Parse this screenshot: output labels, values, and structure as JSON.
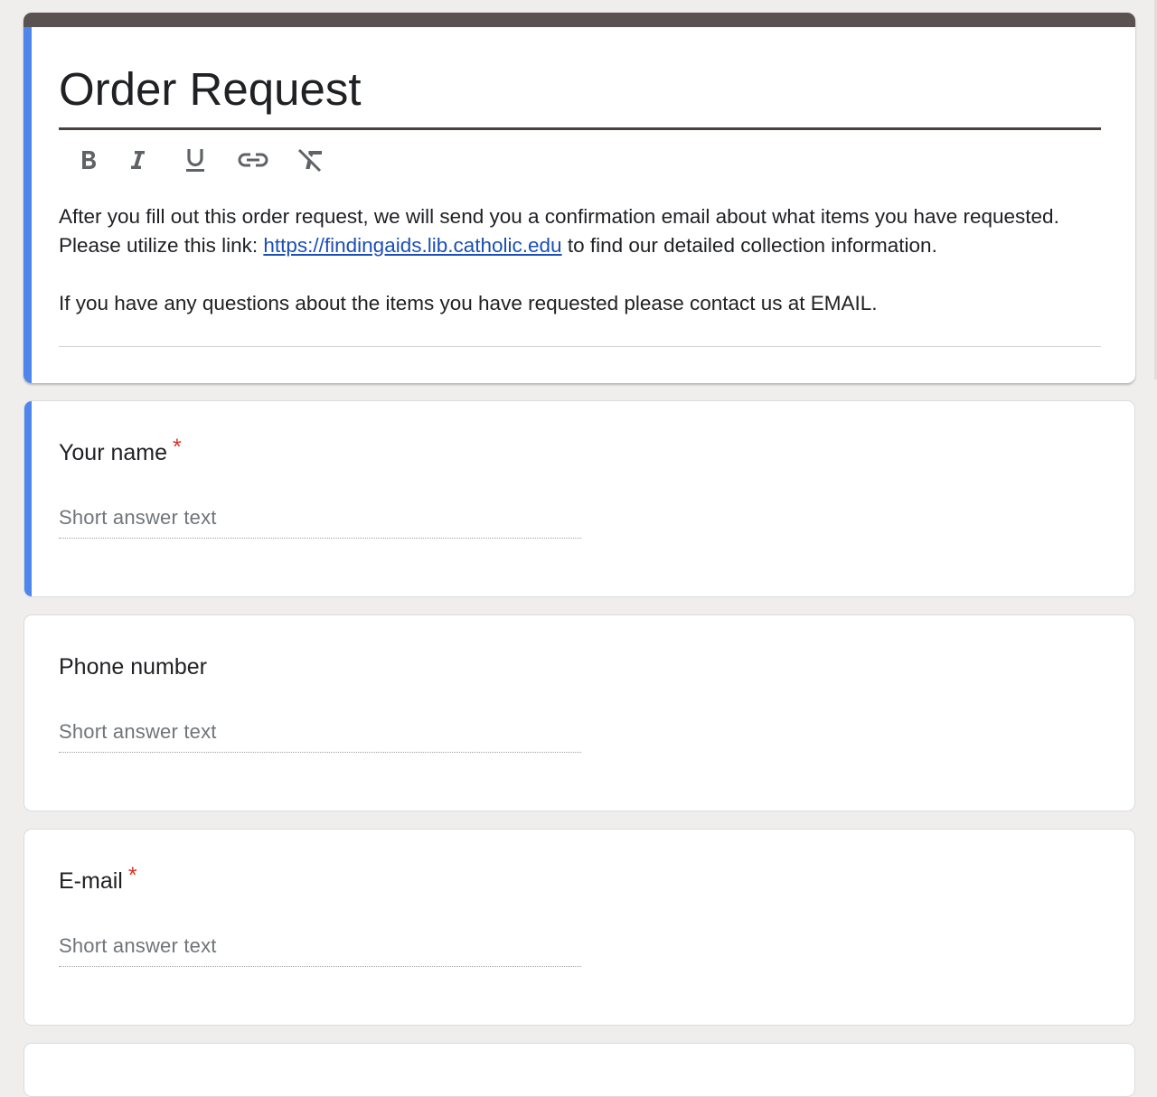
{
  "form": {
    "title": "Order Request",
    "description_part1": "After you fill out this order request, we will send you a confirmation email about what items you have requested. Please utilize this link: ",
    "description_link": "https://findingaids.lib.catholic.edu",
    "description_part2": " to find our detailed collection information.",
    "description_para2": "If you have any questions about the items you have requested please contact us at EMAIL.",
    "accent_color": "#4f86ec",
    "header_bar_color": "#5a5250"
  },
  "toolbar": {
    "items": [
      {
        "name": "bold",
        "icon": "bold-icon"
      },
      {
        "name": "italic",
        "icon": "italic-icon"
      },
      {
        "name": "underline",
        "icon": "underline-icon"
      },
      {
        "name": "link",
        "icon": "link-icon"
      },
      {
        "name": "clear-formatting",
        "icon": "clear-formatting-icon"
      }
    ]
  },
  "questions": [
    {
      "title": "Your name",
      "required": "*",
      "placeholder": "Short answer text"
    },
    {
      "title": "Phone number",
      "placeholder": "Short answer text"
    },
    {
      "title": "E-mail",
      "required": "*",
      "placeholder": "Short answer text"
    }
  ],
  "required_color": "#d93025"
}
